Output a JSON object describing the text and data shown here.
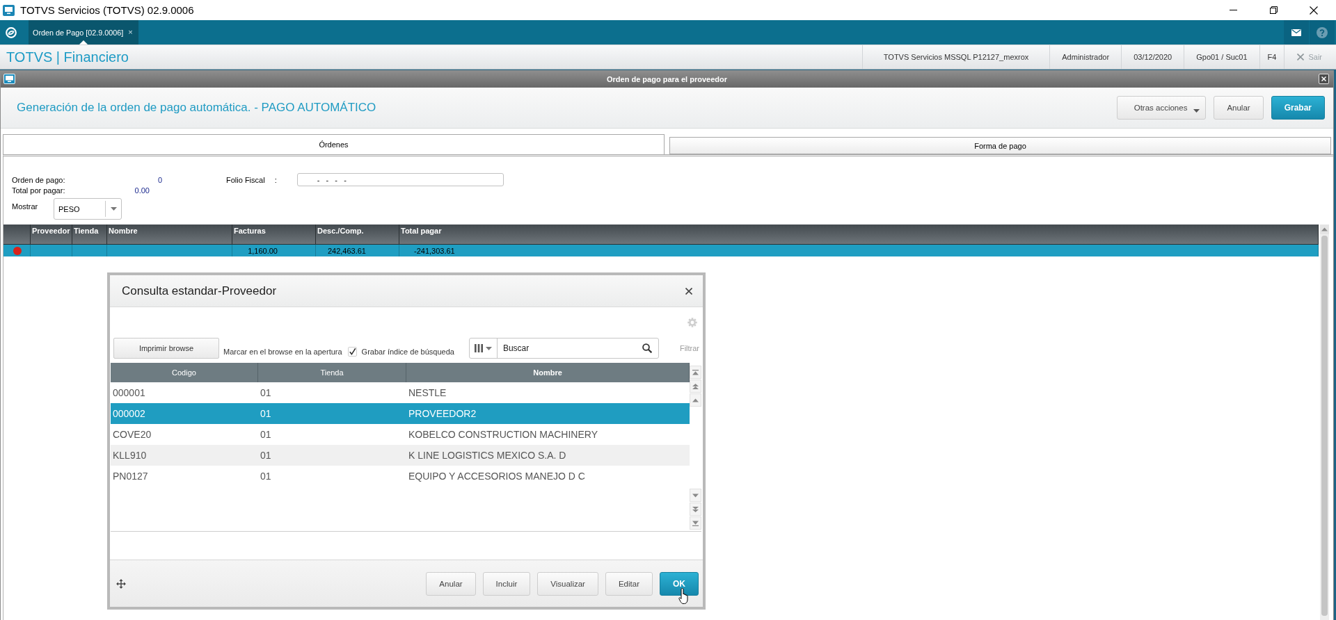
{
  "window": {
    "title": "TOTVS Servicios (TOTVS) 02.9.0006"
  },
  "app_bar": {
    "tabs": [
      {
        "label": "Orden de Pago [02.9.0006]",
        "close": "×",
        "selected": true
      }
    ]
  },
  "header": {
    "brand": "TOTVS | Financiero",
    "status_items": [
      "TOTVS Servicios MSSQL P12127_mexrox",
      "Administrador",
      "03/12/2020",
      "Gpo01 / Suc01",
      "F4"
    ],
    "exit_button": {
      "label": "Sair",
      "disabled": true
    }
  },
  "dialog": {
    "title": "Orden de pago para el proveedor",
    "heading": "Generación de la orden de pago automática. - PAGO AUTOMÁTICO",
    "actions": [
      {
        "label": "Otras acciones",
        "kind": "menu"
      },
      {
        "label": "Anular",
        "kind": "default"
      },
      {
        "label": "Grabar",
        "kind": "primary"
      }
    ],
    "tabs": [
      {
        "label": "Órdenes",
        "selected": true
      },
      {
        "label": "Forma de pago",
        "selected": false
      }
    ],
    "form": {
      "orden_de_pago": {
        "label": "Orden de pago:",
        "value": "0"
      },
      "total_por_pagar": {
        "label": "Total por pagar:",
        "value": "0.00"
      },
      "folio_fiscal": {
        "label": "Folio Fiscal",
        "separator": ":",
        "value": "-   -   -   -"
      },
      "mostrar": {
        "label": "Mostrar",
        "value": "PESO"
      }
    },
    "grid": {
      "columns": [
        "Proveedor",
        "Tienda",
        "Nombre",
        "Facturas",
        "Desc./Comp.",
        "Total pagar"
      ],
      "rows": [
        {
          "selected": true,
          "color": "#d9231b",
          "cells": [
            null,
            null,
            null,
            "1,160.00",
            "242,463.61",
            "-241,303.61"
          ]
        }
      ]
    }
  },
  "lookup": {
    "title": "Consulta estandar-Proveedor",
    "print_button": "Imprimir browse",
    "mark_label": "Marcar en el browse en la apertura",
    "save_index": {
      "label": "Grabar índice de búsqueda",
      "checked": true
    },
    "search": {
      "placeholder": "Buscar"
    },
    "filter": {
      "label": "Filtrar",
      "disabled": true
    },
    "columns": [
      {
        "label": "Codigo",
        "selected": false
      },
      {
        "label": "Tienda",
        "selected": false
      },
      {
        "label": "Nombre",
        "selected": true
      }
    ],
    "rows": [
      {
        "cells": [
          "000001",
          "01",
          "NESTLE"
        ],
        "selected": false
      },
      {
        "cells": [
          "000002",
          "01",
          "PROVEEDOR2"
        ],
        "selected": true
      },
      {
        "cells": [
          "COVE20",
          "01",
          "KOBELCO CONSTRUCTION MACHINERY"
        ],
        "selected": false
      },
      {
        "cells": [
          "KLL910",
          "01",
          "K LINE LOGISTICS MEXICO S.A. D"
        ],
        "selected": false
      },
      {
        "cells": [
          "PN0127",
          "01",
          "EQUIPO Y ACCESORIOS MANEJO D C"
        ],
        "selected": false
      }
    ],
    "buttons": [
      {
        "label": "Anular",
        "kind": "default"
      },
      {
        "label": "Incluir",
        "kind": "default"
      },
      {
        "label": "Visualizar",
        "kind": "default"
      },
      {
        "label": "Editar",
        "kind": "default"
      },
      {
        "label": "OK",
        "kind": "primary"
      }
    ]
  }
}
